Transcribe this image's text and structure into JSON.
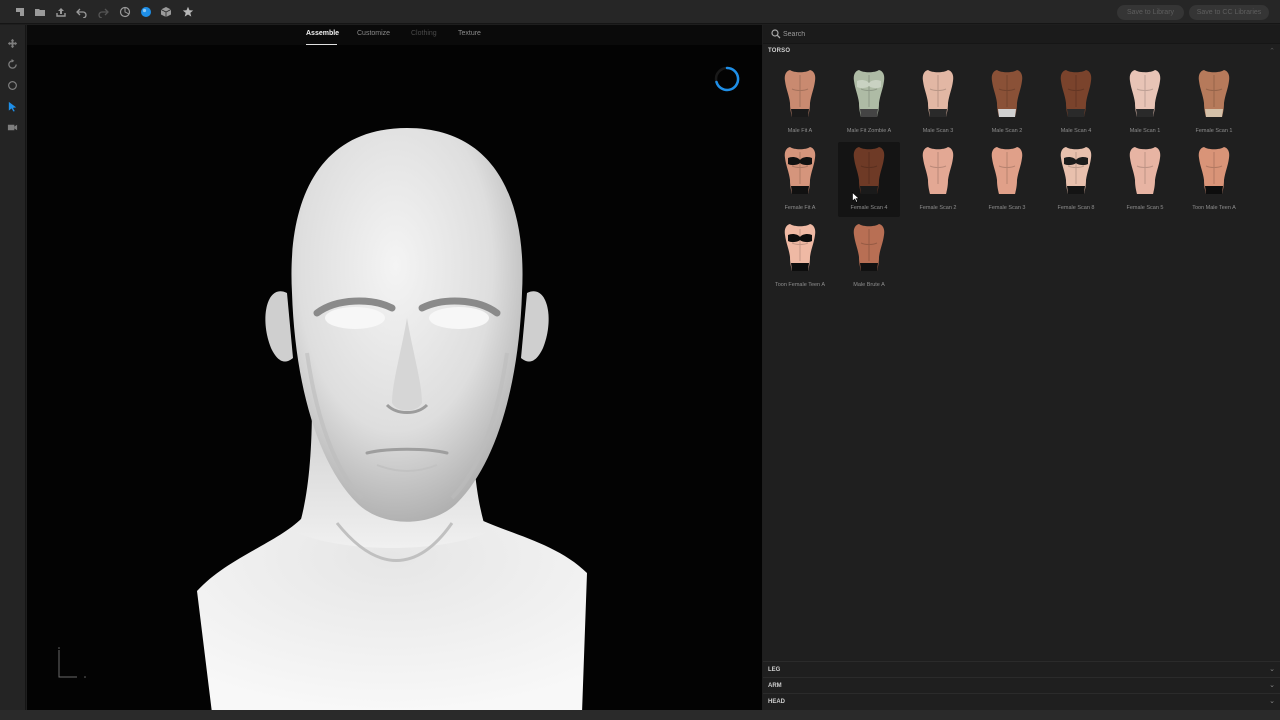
{
  "toolbar": {
    "icons": [
      "menu-icon",
      "folder-open-icon",
      "export-icon",
      "undo-icon",
      "redo-icon",
      "cube-outline-icon",
      "sphere-icon",
      "cube-solid-icon",
      "star-icon"
    ],
    "btn_left": "Save to Library",
    "btn_right": "Save to CC Libraries"
  },
  "leftbar": {
    "icons": [
      "move-icon",
      "rotate-icon",
      "orbit-icon",
      "select-icon",
      "camera-icon"
    ]
  },
  "tabs": [
    {
      "label": "Assemble",
      "state": "active"
    },
    {
      "label": "Customize",
      "state": "normal"
    },
    {
      "label": "Clothing",
      "state": "disabled"
    },
    {
      "label": "Texture",
      "state": "normal"
    }
  ],
  "search": {
    "placeholder": "Search"
  },
  "section": {
    "label": "TORSO"
  },
  "torso_items": [
    {
      "label": "Male Fit A",
      "skin": "#c98a70",
      "bottom": "#1a1a1a",
      "top": ""
    },
    {
      "label": "Male Fit Zombie A",
      "skin": "#aebba5",
      "bottom": "#444444",
      "top": "#c9d2c2"
    },
    {
      "label": "Male Scan 3",
      "skin": "#e2b7a4",
      "bottom": "#2a2a2a",
      "top": ""
    },
    {
      "label": "Male Scan 2",
      "skin": "#8a5137",
      "bottom": "#d0d0d0",
      "top": ""
    },
    {
      "label": "Male Scan 4",
      "skin": "#7a432c",
      "bottom": "#2a2a2a",
      "top": ""
    },
    {
      "label": "Male Scan 1",
      "skin": "#e8c4b6",
      "bottom": "#2a2a2a",
      "top": ""
    },
    {
      "label": "Female Scan 1",
      "skin": "#b67a5b",
      "bottom": "#d4c0a8",
      "top": ""
    },
    {
      "label": "Female Fit A",
      "skin": "#d5957c",
      "bottom": "#111111",
      "top": "#111111"
    },
    {
      "label": "Female Scan 4",
      "skin": "#6e3a26",
      "bottom": "#1a1a1a",
      "top": ""
    },
    {
      "label": "Female Scan 2",
      "skin": "#e3a894",
      "bottom": "#e3a894",
      "top": ""
    },
    {
      "label": "Female Scan 3",
      "skin": "#e0a089",
      "bottom": "#e0a089",
      "top": ""
    },
    {
      "label": "Female Scan 8",
      "skin": "#e8c0ad",
      "bottom": "#141414",
      "top": "#1c1c1c"
    },
    {
      "label": "Female Scan 5",
      "skin": "#e7b4a3",
      "bottom": "#e7b4a3",
      "top": ""
    },
    {
      "label": "Toon Male Teen A",
      "skin": "#d99478",
      "bottom": "#0d0d0d",
      "top": ""
    },
    {
      "label": "Toon Female Teen A",
      "skin": "#efb9a4",
      "bottom": "#0d0d0d",
      "top": "#0d0d0d"
    },
    {
      "label": "Male Brute A",
      "skin": "#b86f54",
      "bottom": "#111111",
      "top": ""
    }
  ],
  "accordion": [
    {
      "label": "LEG"
    },
    {
      "label": "ARM"
    },
    {
      "label": "HEAD"
    }
  ],
  "colors": {
    "accent": "#1e8fe8",
    "background": "#030303",
    "panel": "#1f1f1f"
  }
}
